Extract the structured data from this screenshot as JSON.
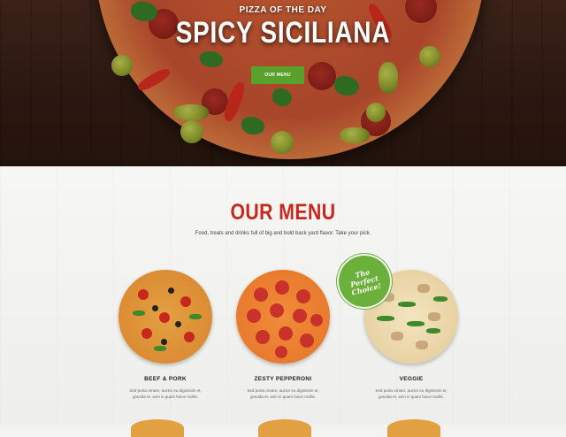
{
  "hero": {
    "kicker": "PIZZA OF THE DAY",
    "title": "SPICY SICILIANA",
    "button_label": "OUR MENU"
  },
  "menu": {
    "title": "OUR MENU",
    "subtitle": "Food, treats and drinks full of big and bold back yard flavor. Take your pick.",
    "badge_lines": [
      "The",
      "Perfect",
      "Choice!"
    ],
    "items": [
      {
        "name": "BEEF & PORK",
        "desc": "Sed porta ornare, auctor eu dignissim et, gravida et, sem in quam fusce mollis."
      },
      {
        "name": "ZESTY PEPPERONI",
        "desc": "Sed porta ornare, auctor eu dignissim et, gravida et, sem in quam fusce mollis."
      },
      {
        "name": "VEGGIE",
        "desc": "Sed porta ornare, auctor eu dignissim et, gravida et, sem in quam fusce mollis."
      }
    ]
  },
  "colors": {
    "accent_red": "#c8271d",
    "accent_green": "#5aa12b",
    "hero_bg": "#2a1710"
  }
}
